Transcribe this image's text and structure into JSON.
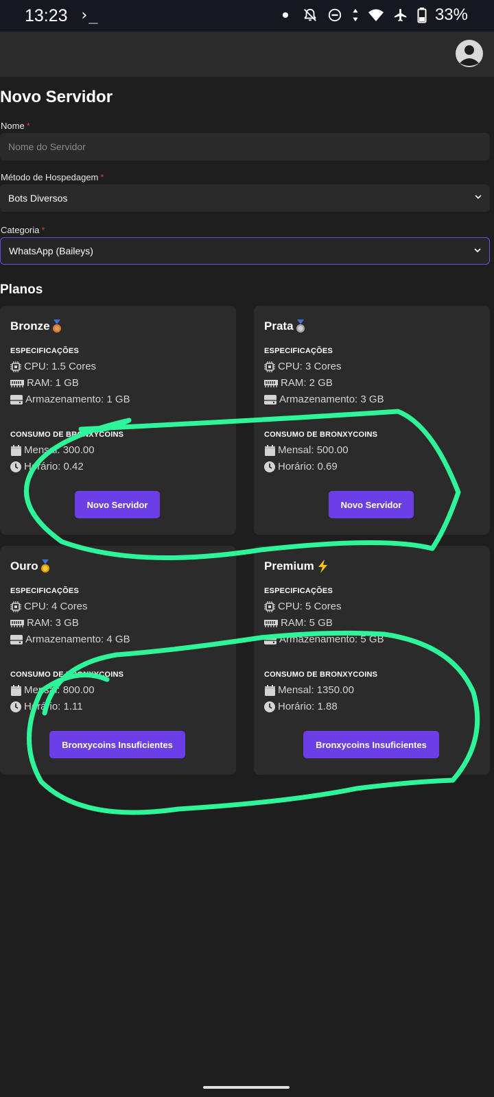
{
  "status_bar": {
    "time": "13:23",
    "terminal_glyph": "›_",
    "battery": "33%",
    "icons": [
      "dot-icon",
      "notifications-off-icon",
      "do-not-disturb-icon",
      "data-arrows-icon",
      "wifi-icon",
      "airplane-icon",
      "battery-icon"
    ]
  },
  "header": {
    "avatar_icon": "account-circle-icon"
  },
  "page": {
    "title": "Novo Servidor",
    "fields": {
      "name": {
        "label": "Nome",
        "required": "*",
        "placeholder": "Nome do Servidor"
      },
      "hosting": {
        "label": "Método de Hospedagem",
        "required": "*",
        "value": "Bots Diversos"
      },
      "category": {
        "label": "Categoria",
        "required": "*",
        "value": "WhatsApp (Baileys)"
      }
    },
    "plans_title": "Planos",
    "labels": {
      "specs": "ESPECIFICAÇÕES",
      "consumption": "CONSUMO DE BRONXYCOINS"
    },
    "plans": [
      {
        "name": "Bronze",
        "badge": "bronze-medal-icon",
        "cpu": "CPU: 1.5 Cores",
        "ram": "RAM: 1 GB",
        "storage": "Armazenamento: 1 GB",
        "monthly": "Mensal: 300.00",
        "hourly": "Horário: 0.42",
        "button": "Novo Servidor"
      },
      {
        "name": "Prata",
        "badge": "silver-medal-icon",
        "cpu": "CPU: 3 Cores",
        "ram": "RAM: 2 GB",
        "storage": "Armazenamento: 3 GB",
        "monthly": "Mensal: 500.00",
        "hourly": "Horário: 0.69",
        "button": "Novo Servidor"
      },
      {
        "name": "Ouro",
        "badge": "gold-medal-icon",
        "cpu": "CPU: 4 Cores",
        "ram": "RAM: 3 GB",
        "storage": "Armazenamento: 4 GB",
        "monthly": "Mensal: 800.00",
        "hourly": "Horário: 1.11",
        "button": "Bronxycoins Insuficientes"
      },
      {
        "name": "Premium",
        "badge": "lightning-icon",
        "cpu": "CPU: 5 Cores",
        "ram": "RAM: 5 GB",
        "storage": "Armazenamento: 5 GB",
        "monthly": "Mensal: 1350.00",
        "hourly": "Horário: 1.88",
        "button": "Bronxycoins Insuficientes"
      }
    ]
  },
  "colors": {
    "background": "#1e1e1e",
    "card": "#2b2b2b",
    "accent_button": "#6c3ee6",
    "focus_border": "#6b4fe0",
    "required": "#e53935",
    "annotation": "#2ef59a"
  }
}
